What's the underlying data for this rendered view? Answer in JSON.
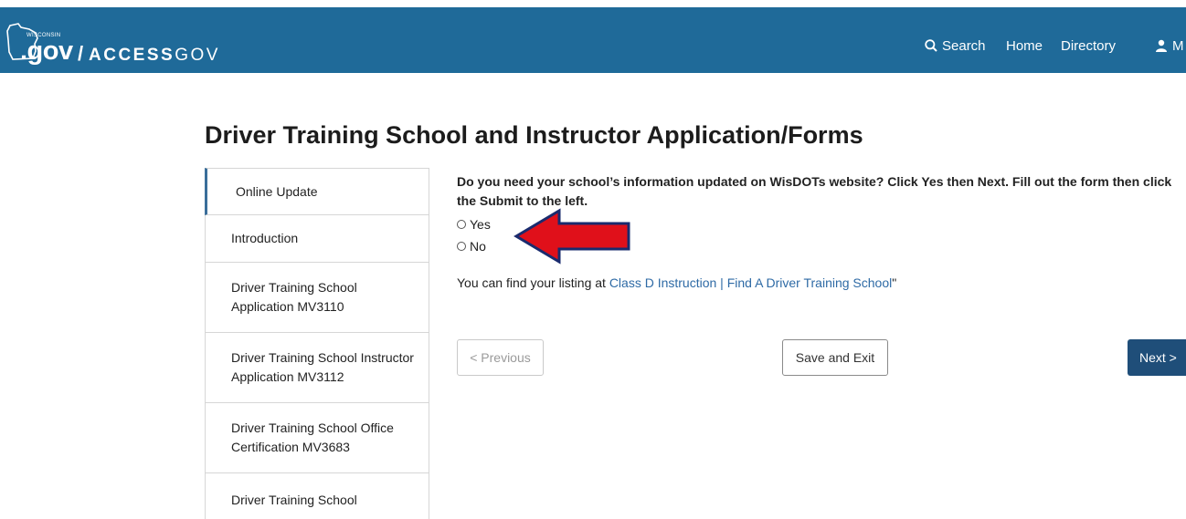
{
  "header": {
    "logo": {
      "small_text": "WISCONSIN",
      "gov_text": ".gov",
      "slash": "/",
      "access_bold": "ACCESS",
      "access_light": "GOV"
    },
    "nav": {
      "search": "Search",
      "home": "Home",
      "directory": "Directory",
      "user_initial": "M"
    },
    "bar_color": "#1f6a99",
    "icons": {
      "search": "search-icon",
      "user": "user-icon"
    }
  },
  "page": {
    "title": "Driver Training School and Instructor Application/Forms"
  },
  "sidebar": {
    "items": [
      {
        "label": "Online Update",
        "active": true
      },
      {
        "label": "Introduction"
      },
      {
        "label": "Driver Training School Application MV3110"
      },
      {
        "label": "Driver Training School Instructor Application MV3112"
      },
      {
        "label": "Driver Training School Office Certification MV3683"
      },
      {
        "label": "Driver Training School"
      }
    ]
  },
  "form": {
    "question": "Do you need your school’s information updated on WisDOTs website? Click Yes then Next. Fill out the form then click the Submit to the left.",
    "options": [
      {
        "label": "Yes",
        "selected": false
      },
      {
        "label": "No",
        "selected": false
      }
    ],
    "listing_prefix": "You can find your listing at ",
    "listing_link": "Class D Instruction | Find A Driver Training School",
    "listing_suffix": "\""
  },
  "buttons": {
    "previous": "< Previous",
    "save_exit": "Save and Exit",
    "next": "Next >"
  },
  "colors": {
    "accent": "#1f4e79",
    "link": "#2e6aa5",
    "annotation_arrow": "#e0101a"
  }
}
